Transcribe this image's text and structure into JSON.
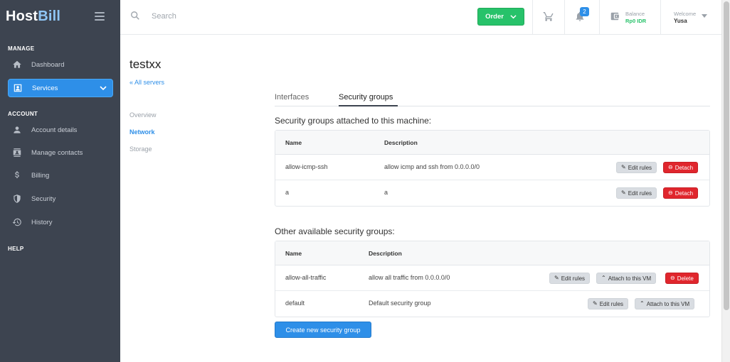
{
  "brand": {
    "host": "Host",
    "bill": "Bill"
  },
  "sidebar": {
    "sections": {
      "manage": "MANAGE",
      "account": "ACCOUNT",
      "help": "HELP"
    },
    "items": [
      {
        "label": "Dashboard",
        "icon": "home-icon"
      },
      {
        "label": "Services",
        "icon": "services-icon"
      },
      {
        "label": "Account details",
        "icon": "user-icon"
      },
      {
        "label": "Manage contacts",
        "icon": "contacts-icon"
      },
      {
        "label": "Billing",
        "icon": "dollar-icon"
      },
      {
        "label": "Security",
        "icon": "shield-icon"
      },
      {
        "label": "History",
        "icon": "history-icon"
      }
    ]
  },
  "topbar": {
    "search_placeholder": "Search",
    "order_label": "Order",
    "notifications_count": "2",
    "balance_label": "Balance",
    "balance_value": "Rp0 IDR",
    "welcome_label": "Welcome",
    "user_name": "Yusa"
  },
  "page": {
    "title": "testxx",
    "back_link": "« All servers",
    "sub_nav": [
      "Overview",
      "Network",
      "Storage"
    ],
    "tabs": [
      "Interfaces",
      "Security groups"
    ]
  },
  "attached": {
    "heading": "Security groups attached to this machine:",
    "columns": [
      "Name",
      "Description"
    ],
    "rows": [
      {
        "name": "allow-icmp-ssh",
        "description": "allow icmp and ssh from 0.0.0.0/0"
      },
      {
        "name": "a",
        "description": "a"
      }
    ],
    "edit_label": "Edit rules",
    "detach_label": "Detach"
  },
  "available": {
    "heading": "Other available security groups:",
    "columns": [
      "Name",
      "Description"
    ],
    "rows": [
      {
        "name": "allow-all-traffic",
        "description": "allow all traffic from 0.0.0.0/0"
      },
      {
        "name": "default",
        "description": "Default security group"
      }
    ],
    "edit_label": "Edit rules",
    "attach_label": "Attach to this VM",
    "delete_label": "Delete"
  },
  "create_button": "Create new security group",
  "colors": {
    "accent": "#2e8fe8",
    "success": "#27c26a",
    "danger": "#e0262d",
    "sidebar": "#3d4450"
  }
}
